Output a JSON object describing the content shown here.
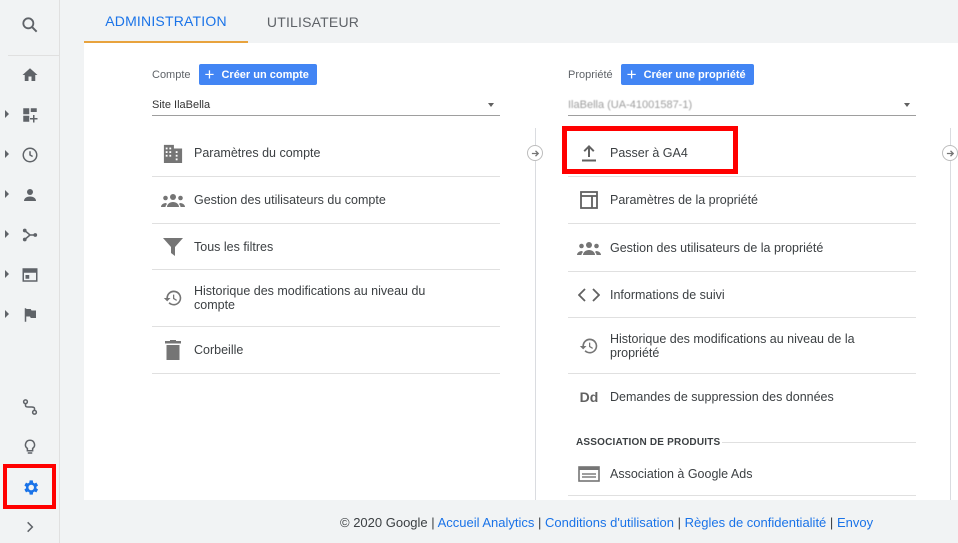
{
  "tabs": [
    {
      "label": "ADMINISTRATION"
    },
    {
      "label": "UTILISATEUR"
    }
  ],
  "rail": {
    "items": [
      "search-icon",
      "home-icon",
      "customization-icon",
      "realtime-icon",
      "audience-icon",
      "acquisition-icon",
      "behavior-icon",
      "conversions-icon",
      "attribution-icon",
      "discover-icon",
      "admin-gear-icon",
      "expand-icon"
    ]
  },
  "account": {
    "label": "Compte",
    "create_button": "Créer un compte",
    "selected": "Site IlaBella",
    "items": [
      {
        "label": "Paramètres du compte",
        "icon": "building-icon"
      },
      {
        "label": "Gestion des utilisateurs du compte",
        "icon": "people-icon"
      },
      {
        "label": "Tous les filtres",
        "icon": "filter-icon"
      },
      {
        "label": "Historique des modifications au niveau du compte",
        "icon": "history-icon"
      },
      {
        "label": "Corbeille",
        "icon": "trash-icon"
      }
    ]
  },
  "property": {
    "label": "Propriété",
    "create_button": "Créer une propriété",
    "selected": "IlaBella (UA-41001587-1)",
    "items": [
      {
        "label": "Passer à GA4",
        "icon": "upload-icon"
      },
      {
        "label": "Paramètres de la propriété",
        "icon": "property-settings-icon"
      },
      {
        "label": "Gestion des utilisateurs de la propriété",
        "icon": "people-icon"
      },
      {
        "label": "Informations de suivi",
        "icon": "code-icon"
      },
      {
        "label": "Historique des modifications au niveau de la propriété",
        "icon": "history-icon"
      },
      {
        "label": "Demandes de suppression des données",
        "icon": "dd-icon"
      }
    ],
    "section_title": "ASSOCIATION DE PRODUITS",
    "links": [
      {
        "label": "Association à Google Ads",
        "icon": "ads-icon"
      }
    ]
  },
  "footer": {
    "copyright": "© 2020 Google",
    "links": [
      "Accueil Analytics",
      "Conditions d'utilisation",
      "Règles de confidentialité",
      "Envoy"
    ]
  },
  "colors": {
    "accent": "#1a73e8",
    "tab_underline": "#e8a33d",
    "button": "#4285f4",
    "highlight": "#ff0000"
  }
}
